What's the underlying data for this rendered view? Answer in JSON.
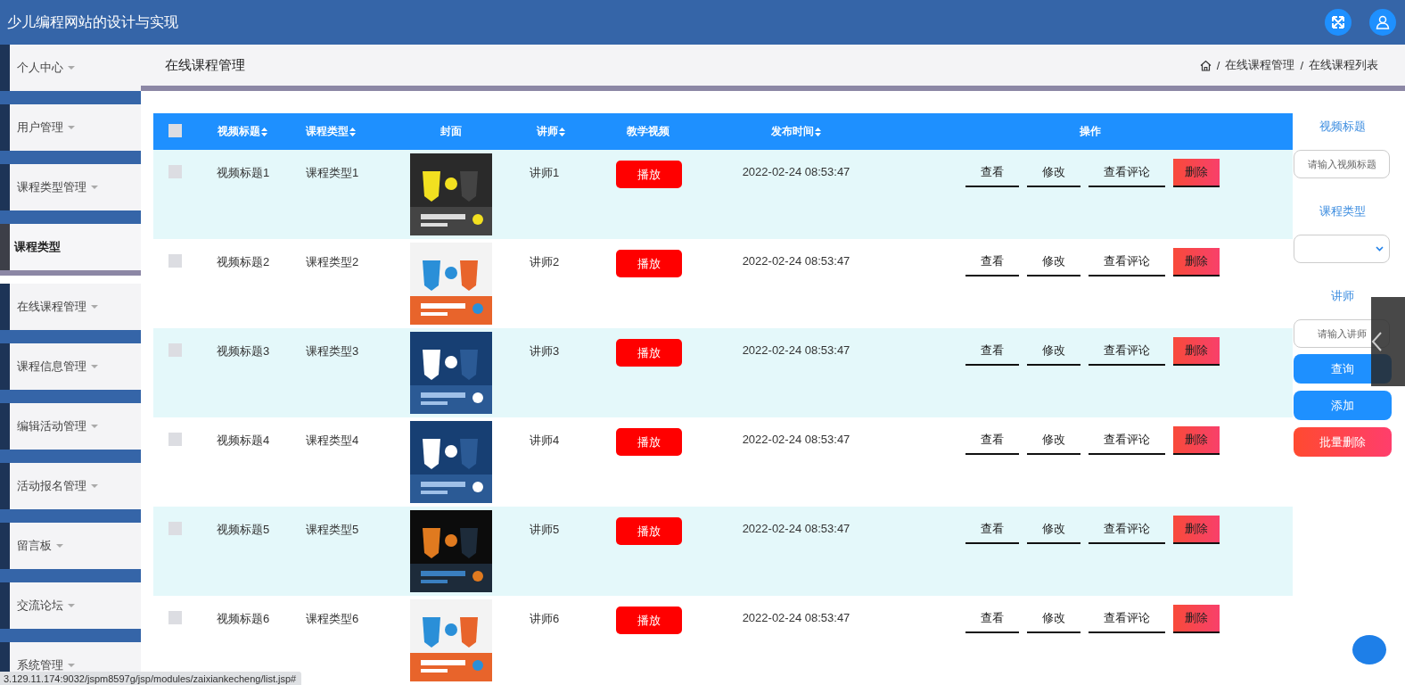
{
  "header": {
    "title": "少儿编程网站的设计与实现"
  },
  "sidebar": {
    "items": [
      {
        "label": "个人中心",
        "selected": false
      },
      {
        "label": "用户管理",
        "selected": false
      },
      {
        "label": "课程类型管理",
        "selected": false
      },
      {
        "label": "课程类型",
        "selected": true
      },
      {
        "label": "在线课程管理",
        "selected": false
      },
      {
        "label": "课程信息管理",
        "selected": false
      },
      {
        "label": "编辑活动管理",
        "selected": false
      },
      {
        "label": "活动报名管理",
        "selected": false
      },
      {
        "label": "留言板",
        "selected": false
      },
      {
        "label": "交流论坛",
        "selected": false
      },
      {
        "label": "系统管理",
        "selected": false
      }
    ]
  },
  "page": {
    "title": "在线课程管理",
    "breadcrumb_separator": "/",
    "breadcrumb": [
      "在线课程管理",
      "在线课程列表"
    ]
  },
  "table": {
    "select_all": {
      "checked": false
    },
    "columns": [
      {
        "label": "视频标题",
        "sortable": true
      },
      {
        "label": "课程类型",
        "sortable": true
      },
      {
        "label": "封面",
        "sortable": false
      },
      {
        "label": "讲师",
        "sortable": true
      },
      {
        "label": "教学视频",
        "sortable": false
      },
      {
        "label": "发布时间",
        "sortable": true
      },
      {
        "label": "操作",
        "sortable": false
      }
    ],
    "rows": [
      {
        "checked": false,
        "title": "视频标题1",
        "type": "课程类型1",
        "teacher": "讲师1",
        "play": "播放",
        "time": "2022-02-24 08:53:47",
        "actions": [
          "查看",
          "修改",
          "查看评论",
          "删除"
        ]
      },
      {
        "checked": false,
        "title": "视频标题2",
        "type": "课程类型2",
        "teacher": "讲师2",
        "play": "播放",
        "time": "2022-02-24 08:53:47",
        "actions": [
          "查看",
          "修改",
          "查看评论",
          "删除"
        ]
      },
      {
        "checked": false,
        "title": "视频标题3",
        "type": "课程类型3",
        "teacher": "讲师3",
        "play": "播放",
        "time": "2022-02-24 08:53:47",
        "actions": [
          "查看",
          "修改",
          "查看评论",
          "删除"
        ]
      },
      {
        "checked": false,
        "title": "视频标题4",
        "type": "课程类型4",
        "teacher": "讲师4",
        "play": "播放",
        "time": "2022-02-24 08:53:47",
        "actions": [
          "查看",
          "修改",
          "查看评论",
          "删除"
        ]
      },
      {
        "checked": false,
        "title": "视频标题5",
        "type": "课程类型5",
        "teacher": "讲师5",
        "play": "播放",
        "time": "2022-02-24 08:53:47",
        "actions": [
          "查看",
          "修改",
          "查看评论",
          "删除"
        ]
      },
      {
        "checked": false,
        "title": "视频标题6",
        "type": "课程类型6",
        "teacher": "讲师6",
        "play": "播放",
        "time": "2022-02-24 08:53:47",
        "actions": [
          "查看",
          "修改",
          "查看评论",
          "删除"
        ]
      }
    ]
  },
  "search_panel": {
    "fields": [
      {
        "label": "视频标题",
        "kind": "input",
        "placeholder": "请输入视频标题"
      },
      {
        "label": "课程类型",
        "kind": "select"
      },
      {
        "label": "讲师",
        "kind": "input",
        "placeholder": "请输入讲师"
      }
    ],
    "buttons": [
      {
        "label": "查询",
        "kind": "primary"
      },
      {
        "label": "添加",
        "kind": "primary"
      },
      {
        "label": "批量删除",
        "kind": "danger"
      }
    ]
  },
  "status_bar": {
    "url": "3.129.11.174:9032/jspm8597g/jsp/modules/zaixiankecheng/list.jsp#"
  }
}
